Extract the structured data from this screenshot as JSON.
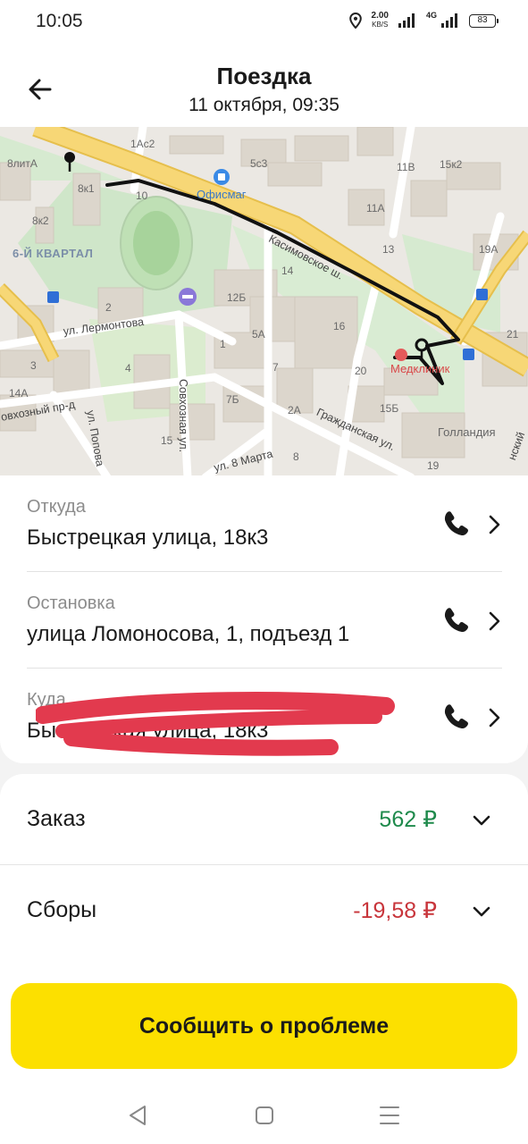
{
  "status_bar": {
    "time": "10:05",
    "net_speed_value": "2.00",
    "net_speed_unit": "KB/S",
    "network_type": "4G",
    "battery_level": "83",
    "icons": [
      "location-icon",
      "signal-icon",
      "signal-4g-icon",
      "battery-icon"
    ]
  },
  "header": {
    "title": "Поездка",
    "subtitle": "11 октября, 09:35",
    "back_icon": "arrow-left-icon"
  },
  "map": {
    "district_label": "6-Й КВАРТАЛ",
    "streets": {
      "kasimovskoe": "Касимовское ш.",
      "lermontova": "ул. Лермонтова",
      "sovkhoznaya": "Совхозная ул.",
      "sovkhozny_proezd": "овхозный пр-д",
      "popova": "ул. Попова",
      "grazhdanskaya": "Гражданская ул.",
      "vosmogo_marta": "ул. 8 Марта",
      "edge": "нский"
    },
    "pois": {
      "ofismag": "Офисмаг",
      "medklinik": "Медклиник",
      "gollandiya": "Голландия"
    },
    "house_numbers": {
      "h8litA": "8литА",
      "h8k1": "8к1",
      "h8k2": "8к2",
      "h1Ac2": "1Ас2",
      "h5c3": "5с3",
      "h10": "10",
      "h11V": "11В",
      "h15k2": "15к2",
      "h11A": "11А",
      "h13": "13",
      "h19A": "19А",
      "h14": "14",
      "h12B": "12Б",
      "h16": "16",
      "h21": "21",
      "h5A": "5А",
      "h1": "1",
      "h2": "2",
      "h3": "3",
      "h4": "4",
      "h7": "7",
      "h7B": "7Б",
      "h20": "20",
      "h14A": "14А",
      "h15B": "15Б",
      "h2A": "2А",
      "h15": "15",
      "h19": "19",
      "h8": "8"
    }
  },
  "addresses": [
    {
      "label": "Откуда",
      "value": "Быстрецкая улица, 18к3"
    },
    {
      "label": "Остановка",
      "value": "улица Ломоносова, 1, подъезд 1"
    },
    {
      "label": "Куда",
      "value": "Быстрецкая улица, 18к3"
    }
  ],
  "costs": [
    {
      "label": "Заказ",
      "value": "562 ₽",
      "color": "#1f8a4c"
    },
    {
      "label": "Сборы",
      "value": "-19,58 ₽",
      "color": "#c8353b"
    }
  ],
  "report_button": "Сообщить о проблеме",
  "nav": {
    "back": "nav-back-icon",
    "home": "nav-home-icon",
    "menu": "nav-menu-icon"
  },
  "colors": {
    "accent_yellow": "#fce000",
    "price_green": "#1f8a4c",
    "price_red": "#c8353b",
    "redaction": "#e23a4e"
  }
}
